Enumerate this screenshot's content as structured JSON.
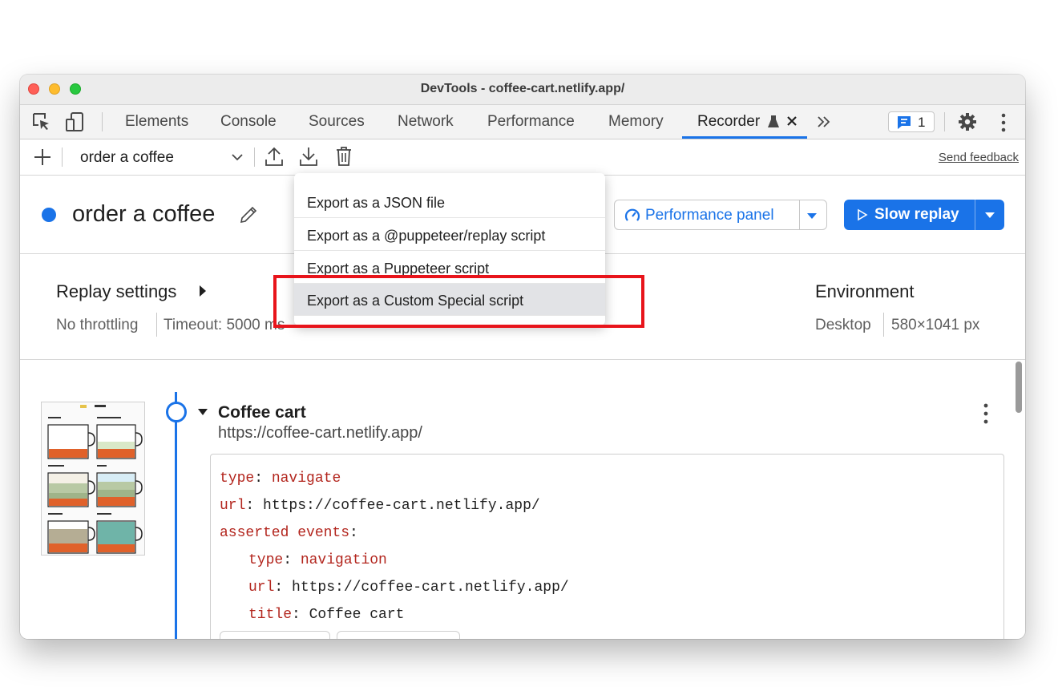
{
  "window": {
    "title": "DevTools - coffee-cart.netlify.app/"
  },
  "tabs": [
    {
      "label": "Elements"
    },
    {
      "label": "Console"
    },
    {
      "label": "Sources"
    },
    {
      "label": "Network"
    },
    {
      "label": "Performance"
    },
    {
      "label": "Memory"
    },
    {
      "label": "Recorder"
    }
  ],
  "issues_badge": {
    "count": "1"
  },
  "toolbar": {
    "recording_select": "order a coffee",
    "send_feedback": "Send feedback"
  },
  "header": {
    "title": "order a coffee",
    "performance_panel": "Performance panel",
    "slow_replay": "Slow replay"
  },
  "replay_settings": {
    "title": "Replay settings",
    "throttling": "No throttling",
    "timeout": "Timeout: 5000 ms"
  },
  "environment": {
    "title": "Environment",
    "device": "Desktop",
    "size": "580×1041 px"
  },
  "step": {
    "title": "Coffee cart",
    "url": "https://coffee-cart.netlify.app/",
    "code": {
      "type_key": "type",
      "type_val": "navigate",
      "url_key": "url",
      "url_val": "https://coffee-cart.netlify.app/",
      "asserted_key": "asserted events",
      "ev_type_key": "type",
      "ev_type_val": "navigation",
      "ev_url_key": "url",
      "ev_url_val": "https://coffee-cart.netlify.app/",
      "ev_title_key": "title",
      "ev_title_val": "Coffee cart"
    }
  },
  "export_menu": {
    "items": [
      {
        "label": "Export as a JSON file"
      },
      {
        "label": "Export as a @puppeteer/replay script"
      },
      {
        "label": "Export as a Puppeteer script"
      },
      {
        "label": "Export as a Custom Special script"
      }
    ],
    "highlighted_index": 3
  },
  "colors": {
    "accent": "#1a73e8",
    "highlight_box": "#e8141b",
    "code_key": "#b3261e"
  }
}
